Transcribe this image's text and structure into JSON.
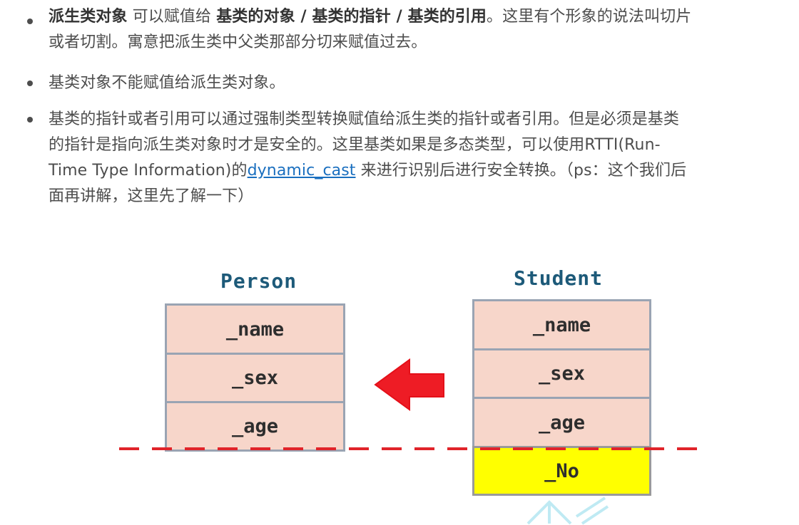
{
  "bullets": [
    {
      "bold1": "派生类对象",
      "text1": " 可以赋值给 ",
      "bold2": "基类的对象 / 基类的指针 / 基类的引用",
      "text2a": "。这里有个形象的说法叫切片",
      "text2b": "或者切割。寓意把派生类中父类那部分切来赋值过去。"
    },
    {
      "text": "基类对象不能赋值给派生类对象。"
    },
    {
      "line1": "基类的指针或者引用可以通过强制类型转换赋值给派生类的指针或者引用。但是必须是基类",
      "line2": "的指针是指向派生类对象时才是安全的。这里基类如果是多态类型，可以使用RTTI(Run-",
      "line3a": "Time Type Information)的",
      "link": "dynamic_cast",
      "line3b": " 来进行识别后进行安全转换。（ps：这个我们后",
      "line4": "面再讲解，这里先了解一下）"
    }
  ],
  "diagram": {
    "base": {
      "title": "Person",
      "fields": [
        "_name",
        "_sex",
        "_age"
      ]
    },
    "derived": {
      "title": "Student",
      "fields": [
        "_name",
        "_sex",
        "_age",
        "_No"
      ]
    },
    "arrow_color": "#ee1c25",
    "cut_line_color": "#e0242a",
    "base_fill": "#f7d6ca",
    "extra_fill": "#ffff00"
  }
}
